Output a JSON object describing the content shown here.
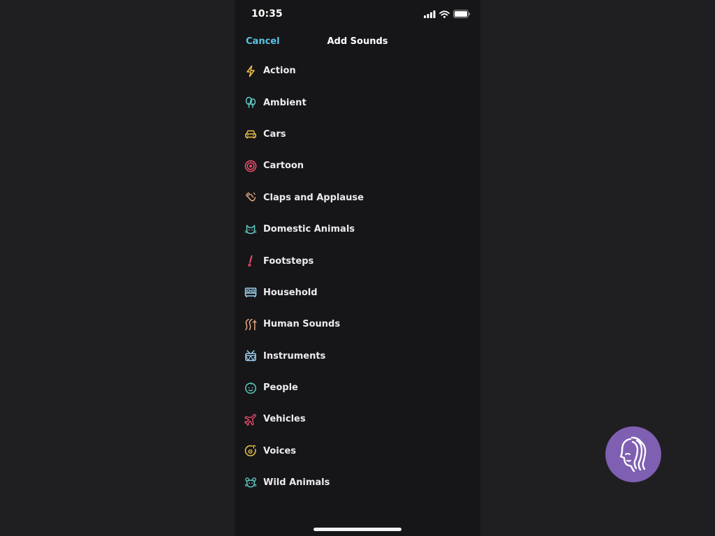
{
  "status_bar": {
    "time": "10:35"
  },
  "header": {
    "cancel_label": "Cancel",
    "title": "Add Sounds"
  },
  "categories": [
    {
      "label": "Action",
      "icon": "lightning-icon",
      "color": "#f0c34a"
    },
    {
      "label": "Ambient",
      "icon": "trees-icon",
      "color": "#5fc9c2"
    },
    {
      "label": "Cars",
      "icon": "car-icon",
      "color": "#f0c34a"
    },
    {
      "label": "Cartoon",
      "icon": "target-icon",
      "color": "#f0506e"
    },
    {
      "label": "Claps and Applause",
      "icon": "clapping-hands-icon",
      "color": "#f2b38a"
    },
    {
      "label": "Domestic Animals",
      "icon": "cat-icon",
      "color": "#5fc9c2"
    },
    {
      "label": "Footsteps",
      "icon": "exclamation-icon",
      "color": "#f0506e"
    },
    {
      "label": "Household",
      "icon": "bed-icon",
      "color": "#9fd3f2"
    },
    {
      "label": "Human Sounds",
      "icon": "human-sounds-icon",
      "color": "#f2b38a"
    },
    {
      "label": "Instruments",
      "icon": "drum-icon",
      "color": "#9fd3f2"
    },
    {
      "label": "People",
      "icon": "baby-face-icon",
      "color": "#5fc9c2"
    },
    {
      "label": "Vehicles",
      "icon": "airplane-icon",
      "color": "#f0506e"
    },
    {
      "label": "Voices",
      "icon": "voice-record-icon",
      "color": "#f0c34a"
    },
    {
      "label": "Wild Animals",
      "icon": "animal-face-icon",
      "color": "#5fc9c2"
    }
  ],
  "colors": {
    "accent": "#5bc4e6",
    "fab_background": "#7f5fb2"
  }
}
